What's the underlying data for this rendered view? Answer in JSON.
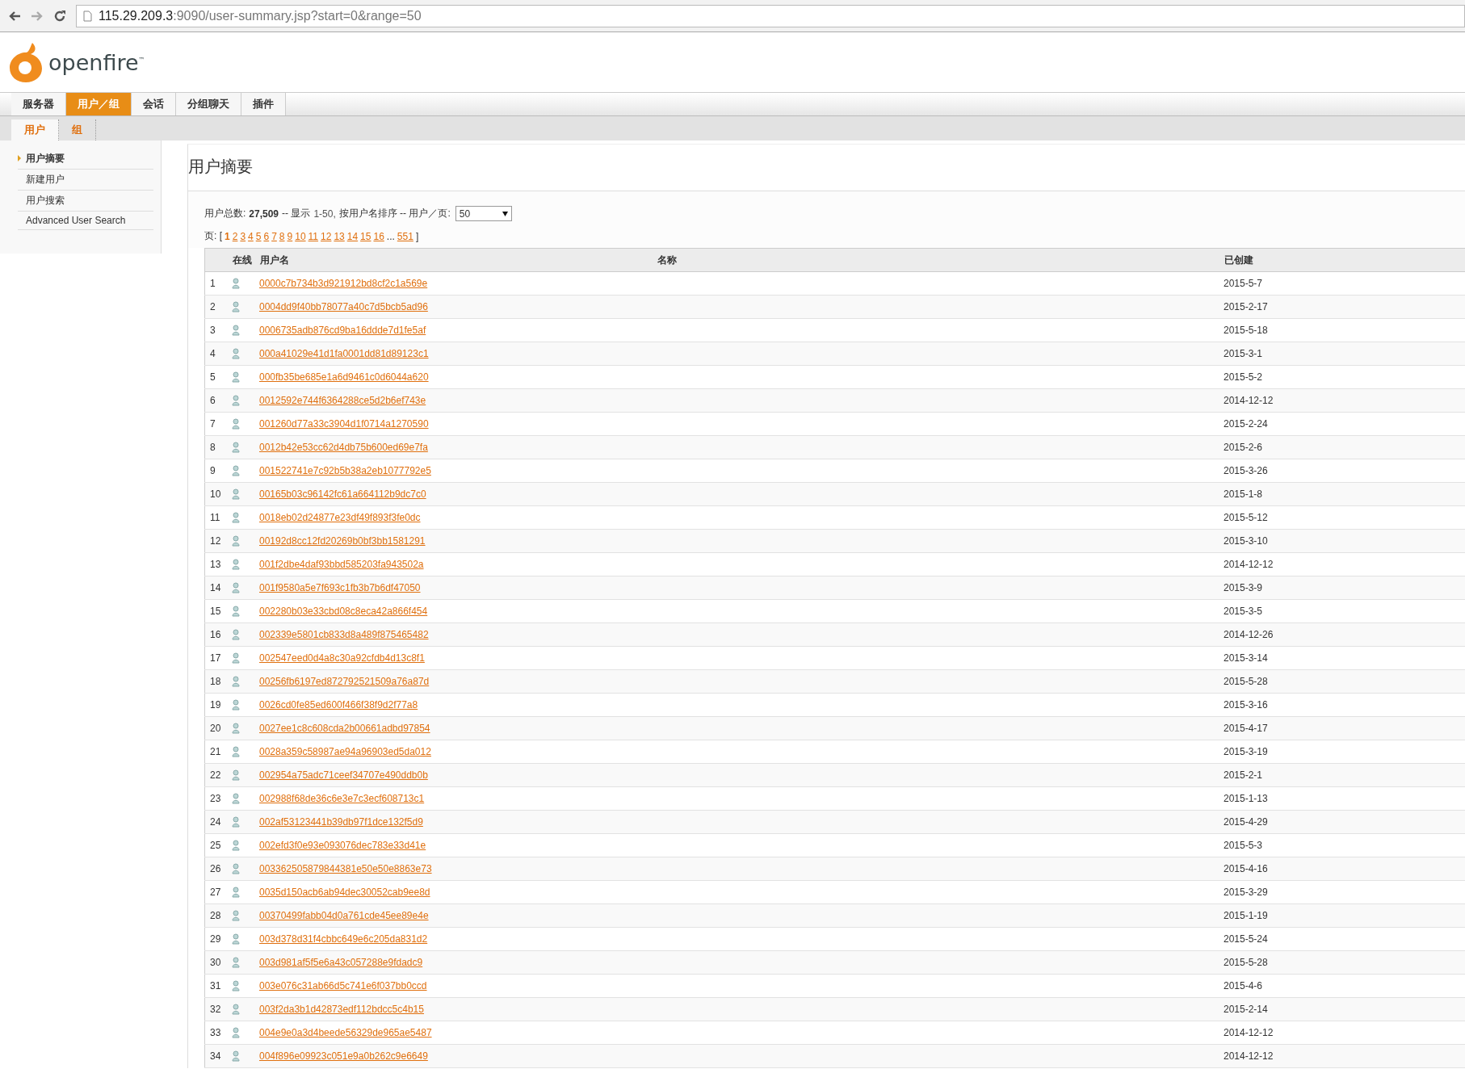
{
  "browser": {
    "url_host": "115.29.209.3",
    "url_rest": ":9090/user-summary.jsp?start=0&range=50"
  },
  "logo": {
    "text": "openfire",
    "mark": "™"
  },
  "nav_tabs": [
    {
      "label": "服务器",
      "selected": false
    },
    {
      "label": "用户／组",
      "selected": true
    },
    {
      "label": "会话",
      "selected": false
    },
    {
      "label": "分组聊天",
      "selected": false
    },
    {
      "label": "插件",
      "selected": false
    }
  ],
  "sub_tabs": [
    {
      "label": "用户",
      "selected": true
    },
    {
      "label": "组",
      "selected": false
    }
  ],
  "sidebar": {
    "items": [
      {
        "label": "用户摘要",
        "selected": true
      },
      {
        "label": "新建用户",
        "selected": false
      },
      {
        "label": "用户搜索",
        "selected": false
      },
      {
        "label": "Advanced User Search",
        "selected": false
      }
    ]
  },
  "page_title": "用户摘要",
  "summary": {
    "total_label": "用户总数:",
    "total": "27,509",
    "showing_label": "-- 显示",
    "range": "1-50,",
    "sort_label": "按用户名排序 -- 用户／页:",
    "per_page": "50"
  },
  "pages": {
    "label": "页:",
    "open": "[",
    "close": "]",
    "ellipsis": "...",
    "items": [
      {
        "label": "1",
        "selected": true
      },
      {
        "label": "2",
        "selected": false
      },
      {
        "label": "3",
        "selected": false
      },
      {
        "label": "4",
        "selected": false
      },
      {
        "label": "5",
        "selected": false
      },
      {
        "label": "6",
        "selected": false
      },
      {
        "label": "7",
        "selected": false
      },
      {
        "label": "8",
        "selected": false
      },
      {
        "label": "9",
        "selected": false
      },
      {
        "label": "10",
        "selected": false
      },
      {
        "label": "11",
        "selected": false
      },
      {
        "label": "12",
        "selected": false
      },
      {
        "label": "13",
        "selected": false
      },
      {
        "label": "14",
        "selected": false
      },
      {
        "label": "15",
        "selected": false
      },
      {
        "label": "16",
        "selected": false
      }
    ],
    "last": "551"
  },
  "table": {
    "columns": [
      "在线",
      "用户名",
      "名称",
      "已创建"
    ],
    "rows": [
      {
        "num": "1",
        "online": false,
        "username": "0000c7b734b3d921912bd8cf2c1a569e",
        "created": "2015-5-7"
      },
      {
        "num": "2",
        "online": false,
        "username": "0004dd9f40bb78077a40c7d5bcb5ad96",
        "created": "2015-2-17"
      },
      {
        "num": "3",
        "online": false,
        "username": "0006735adb876cd9ba16ddde7d1fe5af",
        "created": "2015-5-18"
      },
      {
        "num": "4",
        "online": false,
        "username": "000a41029e41d1fa0001dd81d89123c1",
        "created": "2015-3-1"
      },
      {
        "num": "5",
        "online": false,
        "username": "000fb35be685e1a6d9461c0d6044a620",
        "created": "2015-5-2"
      },
      {
        "num": "6",
        "online": false,
        "username": "0012592e744f6364288ce5d2b6ef743e",
        "created": "2014-12-12"
      },
      {
        "num": "7",
        "online": false,
        "username": "001260d77a33c3904d1f0714a1270590",
        "created": "2015-2-24"
      },
      {
        "num": "8",
        "online": false,
        "username": "0012b42e53cc62d4db75b600ed69e7fa",
        "created": "2015-2-6"
      },
      {
        "num": "9",
        "online": false,
        "username": "001522741e7c92b5b38a2eb1077792e5",
        "created": "2015-3-26"
      },
      {
        "num": "10",
        "online": false,
        "username": "00165b03c96142fc61a664112b9dc7c0",
        "created": "2015-1-8"
      },
      {
        "num": "11",
        "online": false,
        "username": "0018eb02d24877e23df49f893f3fe0dc",
        "created": "2015-5-12"
      },
      {
        "num": "12",
        "online": false,
        "username": "00192d8cc12fd20269b0bf3bb1581291",
        "created": "2015-3-10"
      },
      {
        "num": "13",
        "online": false,
        "username": "001f2dbe4daf93bbd585203fa943502a",
        "created": "2014-12-12"
      },
      {
        "num": "14",
        "online": false,
        "username": "001f9580a5e7f693c1fb3b7b6df47050",
        "created": "2015-3-9"
      },
      {
        "num": "15",
        "online": false,
        "username": "002280b03e33cbd08c8eca42a866f454",
        "created": "2015-3-5"
      },
      {
        "num": "16",
        "online": false,
        "username": "002339e5801cb833d8a489f875465482",
        "created": "2014-12-26"
      },
      {
        "num": "17",
        "online": false,
        "username": "002547eed0d4a8c30a92cfdb4d13c8f1",
        "created": "2015-3-14"
      },
      {
        "num": "18",
        "online": false,
        "username": "00256fb6197ed872792521509a76a87d",
        "created": "2015-5-28"
      },
      {
        "num": "19",
        "online": false,
        "username": "0026cd0fe85ed600f466f38f9d2f77a8",
        "created": "2015-3-16"
      },
      {
        "num": "20",
        "online": false,
        "username": "0027ee1c8c608cda2b00661adbd97854",
        "created": "2015-4-17"
      },
      {
        "num": "21",
        "online": false,
        "username": "0028a359c58987ae94a96903ed5da012",
        "created": "2015-3-19"
      },
      {
        "num": "22",
        "online": false,
        "username": "002954a75adc71ceef34707e490ddb0b",
        "created": "2015-2-1"
      },
      {
        "num": "23",
        "online": false,
        "username": "002988f68de36c6e3e7c3ecf608713c1",
        "created": "2015-1-13"
      },
      {
        "num": "24",
        "online": false,
        "username": "002af53123441b39db97f1dce132f5d9",
        "created": "2015-4-29"
      },
      {
        "num": "25",
        "online": false,
        "username": "002efd3f0e93e093076dec783e33d41e",
        "created": "2015-5-3"
      },
      {
        "num": "26",
        "online": false,
        "username": "003362505879844381e50e50e8863e73",
        "created": "2015-4-16"
      },
      {
        "num": "27",
        "online": false,
        "username": "0035d150acb6ab94dec30052cab9ee8d",
        "created": "2015-3-29"
      },
      {
        "num": "28",
        "online": false,
        "username": "00370499fabb04d0a761cde45ee89e4e",
        "created": "2015-1-19"
      },
      {
        "num": "29",
        "online": false,
        "username": "003d378d31f4cbbc649e6c205da831d2",
        "created": "2015-5-24"
      },
      {
        "num": "30",
        "online": false,
        "username": "003d981af5f5e6a43c057288e9fdadc9",
        "created": "2015-5-28"
      },
      {
        "num": "31",
        "online": false,
        "username": "003e076c31ab66d5c741e6f037bb0ccd",
        "created": "2015-4-6"
      },
      {
        "num": "32",
        "online": false,
        "username": "003f2da3b1d42873edf112bdcc5c4b15",
        "created": "2015-2-14"
      },
      {
        "num": "33",
        "online": false,
        "username": "004e9e0a3d4beede56329de965ae5487",
        "created": "2014-12-12"
      },
      {
        "num": "34",
        "online": false,
        "username": "004f896e09923c051e9a0b262c9e6649",
        "created": "2014-12-12"
      }
    ]
  }
}
